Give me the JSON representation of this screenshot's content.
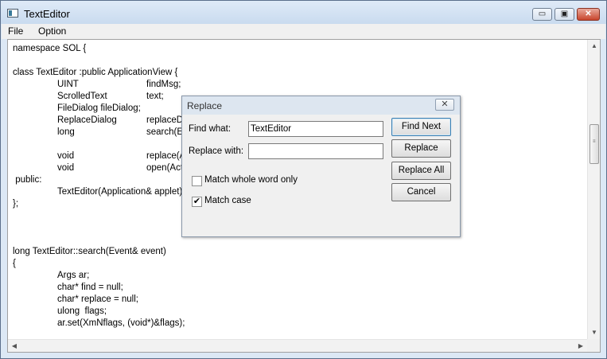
{
  "window": {
    "title": "TextEditor",
    "minimize_glyph": "▭",
    "maximize_glyph": "▣",
    "close_glyph": "✕"
  },
  "menu": [
    "File",
    "Option"
  ],
  "editor": {
    "lines": [
      [
        "namespace SOL {"
      ],
      [
        ""
      ],
      [
        "class TextEditor :public ApplicationView {"
      ],
      [
        "",
        "UINT",
        "findMsg;"
      ],
      [
        "",
        "ScrolledText",
        "text;"
      ],
      [
        "",
        "FileDialog fileDialog;"
      ],
      [
        "",
        "ReplaceDialog",
        "replaceDialog;"
      ],
      [
        "",
        "long",
        "search(Event& event);"
      ],
      [
        ""
      ],
      [
        "",
        "void",
        "replace(Action& action);"
      ],
      [
        "",
        "void",
        "open(Action& action);"
      ],
      [
        " public:"
      ],
      [
        "",
        "TextEditor(Application& applet);"
      ],
      [
        "};"
      ],
      [
        ""
      ],
      [
        ""
      ],
      [
        ""
      ],
      [
        "long TextEditor::search(Event& event)"
      ],
      [
        "{"
      ],
      [
        "",
        "Args ar;"
      ],
      [
        "",
        "char* find = null;"
      ],
      [
        "",
        "char* replace = null;"
      ],
      [
        "",
        "ulong  flags;"
      ],
      [
        "",
        "ar.set(XmNflags, (void*)&flags);"
      ]
    ]
  },
  "scrollbar": {
    "up_glyph": "▲",
    "down_glyph": "▼",
    "left_glyph": "◀",
    "right_glyph": "▶",
    "grip": "≡"
  },
  "dialog": {
    "title": "Replace",
    "close_glyph": "✕",
    "find_label": "Find what:",
    "find_value": "TextEditor",
    "replace_label": "Replace with:",
    "replace_value": "",
    "match_whole_word_label": "Match whole word only",
    "match_whole_word_checked": false,
    "match_case_label": "Match case",
    "match_case_checked": true,
    "check_glyph": "✔",
    "buttons": {
      "find_next": "Find Next",
      "replace": "Replace",
      "replace_all": "Replace All",
      "cancel": "Cancel"
    }
  }
}
